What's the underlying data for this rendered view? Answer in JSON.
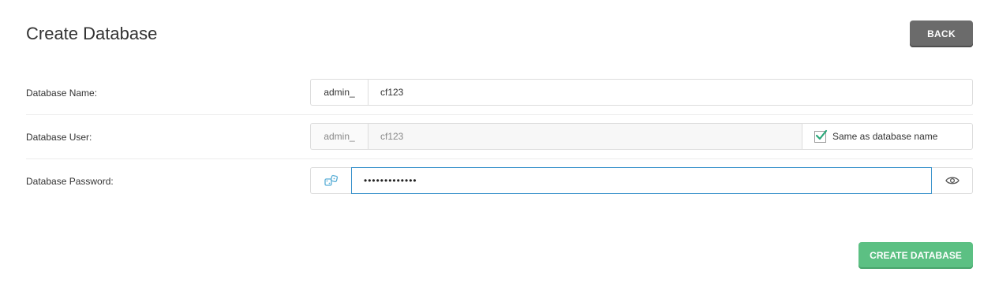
{
  "header": {
    "title": "Create Database",
    "back_label": "BACK"
  },
  "form": {
    "db_name": {
      "label": "Database Name:",
      "prefix": "admin_",
      "value": "cf123"
    },
    "db_user": {
      "label": "Database User:",
      "prefix": "admin_",
      "value": "cf123",
      "same_as_label": "Same as database name",
      "same_as_checked": true
    },
    "db_password": {
      "label": "Database Password:",
      "value": "•••••••••••••",
      "generate_icon": "dice-icon",
      "toggle_icon": "eye-icon"
    }
  },
  "footer": {
    "create_label": "CREATE DATABASE"
  },
  "colors": {
    "primary_button": "#5cc083",
    "back_button": "#6b6b6b",
    "focus_border": "#3b93cc",
    "check_mark": "#2aa87a"
  }
}
